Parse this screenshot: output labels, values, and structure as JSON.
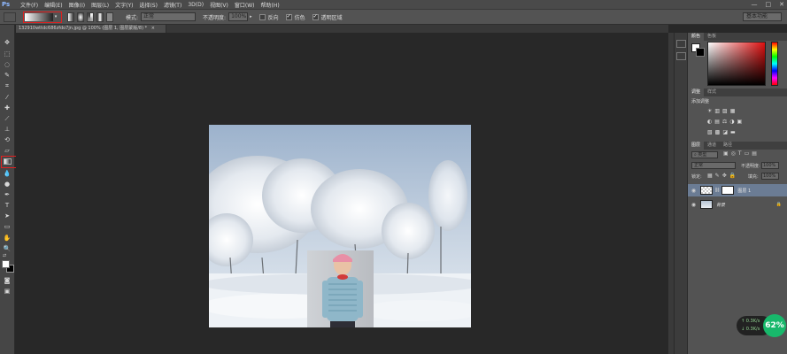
{
  "app": {
    "logo": "Ps"
  },
  "menu": [
    "文件(F)",
    "编辑(E)",
    "图像(I)",
    "图层(L)",
    "文字(Y)",
    "选择(S)",
    "滤镜(T)",
    "3D(D)",
    "视图(V)",
    "窗口(W)",
    "帮助(H)"
  ],
  "window_controls": [
    "—",
    "□",
    "✕"
  ],
  "options": {
    "mode_label": "模式:",
    "mode_value": "正常",
    "opacity_label": "不透明度:",
    "opacity_value": "100%",
    "reverse_label": "反向",
    "dither_label": "仿色",
    "transparency_label": "透明区域",
    "workspace": "基本功能"
  },
  "document": {
    "tab_title": "132910wttdc686zfdo7jn.jpg @ 100% (图层 1, 图层蒙版/8) *",
    "close": "×"
  },
  "panels": {
    "color_tabs": [
      "颜色",
      "色板"
    ],
    "adjust_tabs": [
      "调整",
      "样式"
    ],
    "adjust_title": "添加调整",
    "layers_tabs": [
      "图层",
      "通道",
      "路径"
    ],
    "filter_kind": "类型",
    "blend_mode": "正常",
    "opacity_label": "不透明度:",
    "opacity_value": "100%",
    "lock_label": "锁定:",
    "fill_label": "填充:",
    "fill_value": "100%",
    "layers": [
      {
        "name": "图层 1"
      },
      {
        "name": "背景"
      }
    ]
  },
  "netspeed": {
    "up": "0.3K/s",
    "down": "0.3K/s",
    "percent": "62%"
  },
  "colors": {
    "highlight": "#e02020",
    "accent": "#18b86b"
  }
}
